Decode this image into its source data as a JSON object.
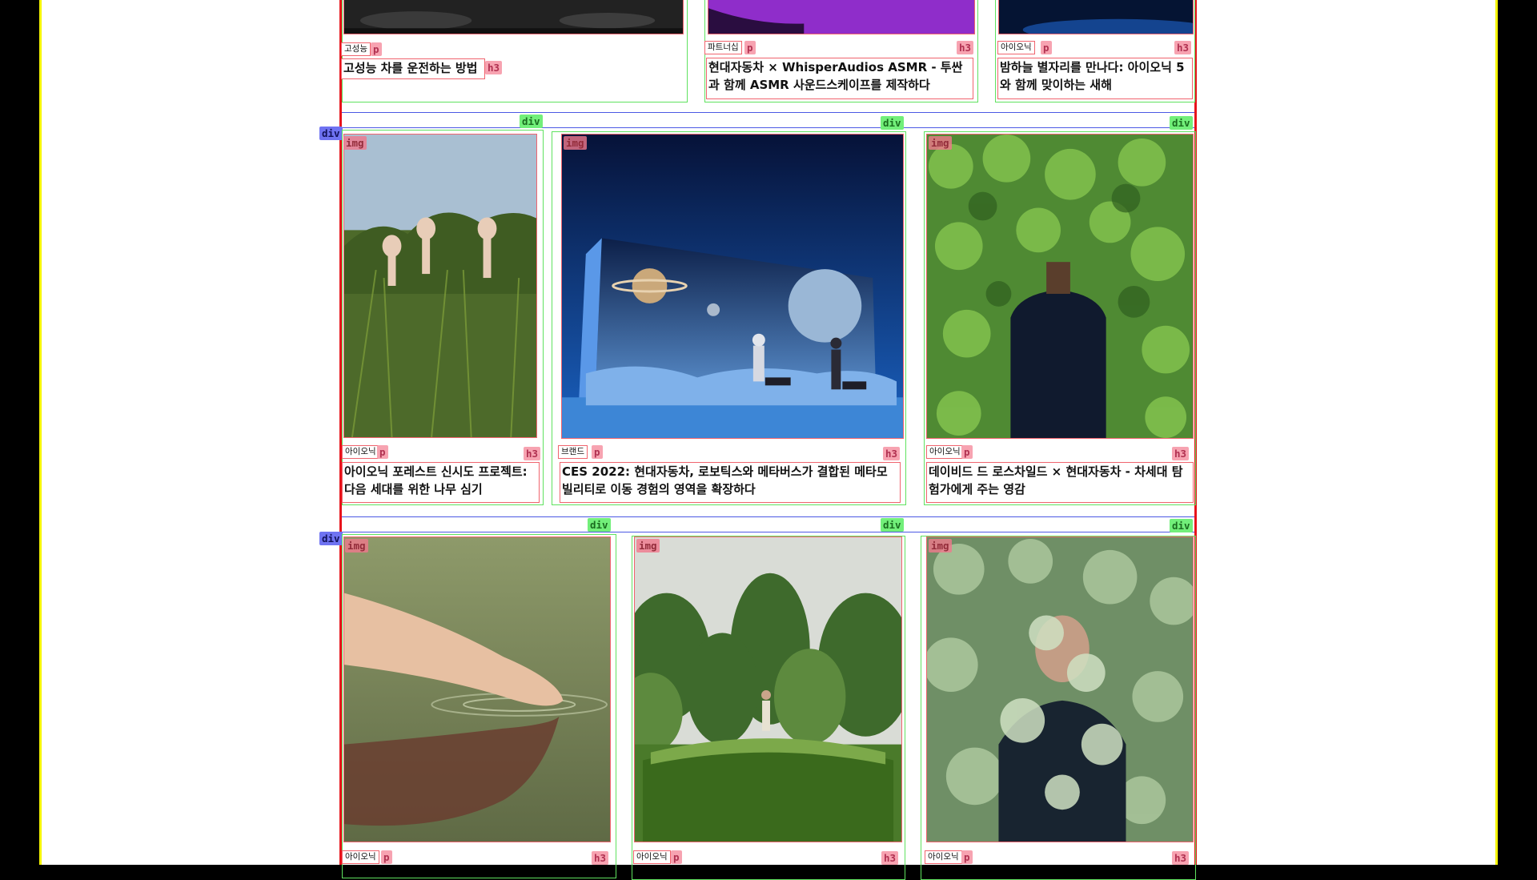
{
  "overlay_tags": {
    "div": "div",
    "img": "img",
    "p": "p",
    "h3": "h3"
  },
  "row0": [
    {
      "category": "고성능",
      "title": "고성능 차를 운전하는 방법"
    },
    {
      "category": "파트너십",
      "title": "현대자동차 × WhisperAudios ASMR - 투싼과 함께 ASMR 사운드스케이프를 제작하다"
    },
    {
      "category": "아이오닉",
      "title": "밤하늘 별자리를 만나다: 아이오닉 5와 함께 맞이하는 새해"
    }
  ],
  "row1": [
    {
      "category": "아이오닉",
      "title": "아이오닉 포레스트 신시도 프로젝트: 다음 세대를 위한 나무 심기"
    },
    {
      "category": "브랜드",
      "title": "CES 2022: 현대자동차, 로보틱스와 메타버스가 결합된 메타모빌리티로 이동 경험의 영역을 확장하다"
    },
    {
      "category": "아이오닉",
      "title": "데이비드 드 로스차일드 × 현대자동차 - 차세대 탐험가에게 주는 영감"
    }
  ],
  "row2": [
    {
      "category": "아이오닉"
    },
    {
      "category": "아이오닉"
    },
    {
      "category": "아이오닉"
    }
  ],
  "colors": {
    "page": "#ffffff",
    "margin": "#000000",
    "outline_yellow": "#f4f400",
    "outline_red": "#e8141c",
    "div_outline": "#5fe25f",
    "div_row_outline": "#4b59e4",
    "element_outline": "#f0646e"
  }
}
